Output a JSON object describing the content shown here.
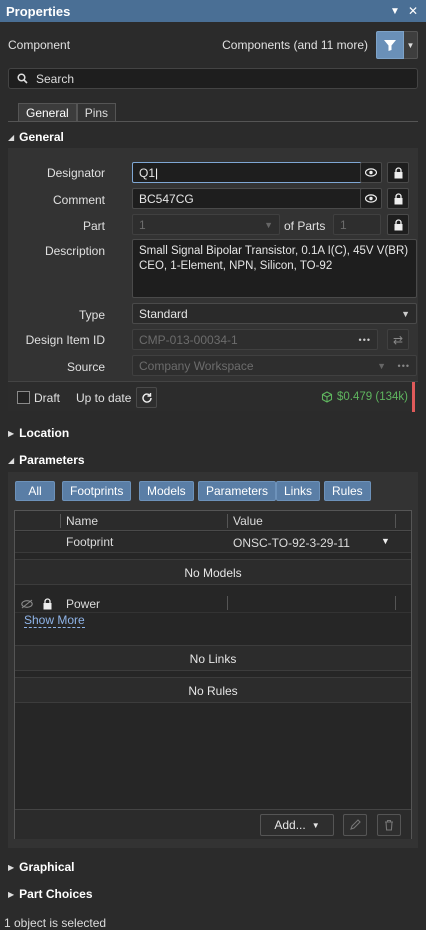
{
  "window": {
    "title": "Properties"
  },
  "component_row": {
    "label": "Component",
    "filter_text": "Components (and 11 more)"
  },
  "search": {
    "placeholder": "Search"
  },
  "tabs": [
    {
      "label": "General"
    },
    {
      "label": "Pins"
    }
  ],
  "general": {
    "header": "General",
    "designator": {
      "label": "Designator",
      "value": "Q1"
    },
    "comment": {
      "label": "Comment",
      "value": "BC547CG"
    },
    "part": {
      "label": "Part",
      "value": "1",
      "of_parts_label": "of Parts",
      "of_parts_value": "1"
    },
    "description": {
      "label": "Description",
      "line1": "Small Signal Bipolar Transistor, 0.1A I(C), 45V V(BR)",
      "line2": "CEO, 1-Element, NPN, Silicon, TO-92"
    },
    "type": {
      "label": "Type",
      "value": "Standard"
    },
    "design_item_id": {
      "label": "Design Item ID",
      "value": "CMP-013-00034-1"
    },
    "source": {
      "label": "Source",
      "value": "Company Workspace"
    },
    "draft_label": "Draft",
    "status_label": "Up to date",
    "price": "$0.479 (134k)"
  },
  "location": {
    "header": "Location"
  },
  "parameters": {
    "header": "Parameters",
    "filters": [
      "All",
      "Footprints",
      "Models",
      "Parameters",
      "Links",
      "Rules"
    ],
    "columns": {
      "name": "Name",
      "value": "Value"
    },
    "footprint_row": {
      "name": "Footprint",
      "value": "ONSC-TO-92-3-29-11"
    },
    "no_models": "No Models",
    "power_row": {
      "name": "Power"
    },
    "show_more": "Show More",
    "no_links": "No Links",
    "no_rules": "No Rules",
    "add_button": "Add..."
  },
  "graphical": {
    "header": "Graphical"
  },
  "part_choices": {
    "header": "Part Choices"
  },
  "status": {
    "text": "1 object is selected"
  },
  "colors": {
    "accent": "#4a6f95",
    "filter_chip": "#5a7ea6",
    "price_green": "#5fb55f",
    "alert_red": "#e05a5a"
  }
}
